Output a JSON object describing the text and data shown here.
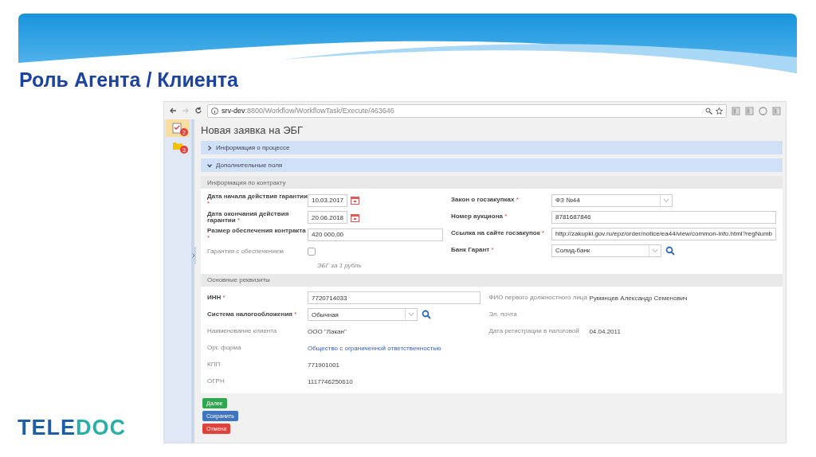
{
  "slide": {
    "title": "Роль Агента / Клиента",
    "logo": {
      "left": "TELE",
      "right": "DOC"
    }
  },
  "browser": {
    "url_host": "srv-dev",
    "url_rest": ":8800/Workflow/WorkflowTask/Execute/463646"
  },
  "sidebar": {
    "items": [
      {
        "kind": "tasks",
        "badge": "2",
        "selected": true
      },
      {
        "kind": "folder",
        "badge": "3",
        "selected": false
      }
    ]
  },
  "page": {
    "title": "Новая заявка на ЭБГ",
    "sections": [
      {
        "label": "Информация о процессе",
        "expanded": false
      },
      {
        "label": "Дополнительные поля",
        "expanded": true
      }
    ],
    "contract": {
      "title": "Информация по контракту",
      "left": [
        {
          "kind": "date",
          "label": "Дата начала действия гарантии",
          "mark": "*",
          "value": "10.03.2017"
        },
        {
          "kind": "date",
          "label": "Дата окончания действия гарантии",
          "mark": "*",
          "value": "20.06.2018"
        },
        {
          "kind": "text",
          "label": "Размер обеспечения контракта",
          "mark": "*",
          "value": "420 000,00"
        },
        {
          "kind": "checkbox",
          "label": "Гарантия с обеспечением",
          "checked": false,
          "hint": "ЭБГ за 1 рубль"
        }
      ],
      "right": [
        {
          "kind": "select",
          "label": "Закон о госзакупках",
          "mark": "*",
          "value": "ФЗ №44"
        },
        {
          "kind": "text",
          "label": "Номер аукциона",
          "mark": "*",
          "value": "8781687846"
        },
        {
          "kind": "text",
          "label": "Ссылка на сайте госзакупок",
          "mark": "*",
          "value": "http://zakupki.gov.ru/epz/order/notice/ea44/view/common-info.html?regNumb"
        },
        {
          "kind": "lookup",
          "label": "Банк Гарант",
          "mark": "*",
          "value": "Солид-банк"
        }
      ]
    },
    "requisites": {
      "title": "Основные реквизиты",
      "left": [
        {
          "kind": "text",
          "label": "ИНН",
          "mark": "*",
          "value": "7720714033"
        },
        {
          "kind": "lookup",
          "label": "Система налогообложения",
          "mark": "*",
          "value": "Обычная"
        },
        {
          "kind": "static",
          "label": "Наименование клиента",
          "value": "ООО \"Лакан\""
        },
        {
          "kind": "link",
          "label": "Орг. форма",
          "value": "Общество с ограниченной ответственностью"
        },
        {
          "kind": "static",
          "label": "КПП",
          "value": "771901001"
        },
        {
          "kind": "static",
          "label": "ОГРН",
          "value": "1117746250610"
        }
      ],
      "right": [
        {
          "kind": "static",
          "label": "ФИО первого должностного лица",
          "value": "Румянцев Александр Семенович"
        },
        {
          "kind": "static",
          "label": "Эл. почта"
        },
        {
          "kind": "static",
          "label": "Дата регистрации в налоговой",
          "value": "04.04.2011"
        }
      ]
    },
    "buttons": [
      {
        "label": "Далее",
        "kind": "next"
      },
      {
        "label": "Сохранить",
        "kind": "save"
      },
      {
        "label": "Отмена",
        "kind": "cancel"
      }
    ]
  }
}
